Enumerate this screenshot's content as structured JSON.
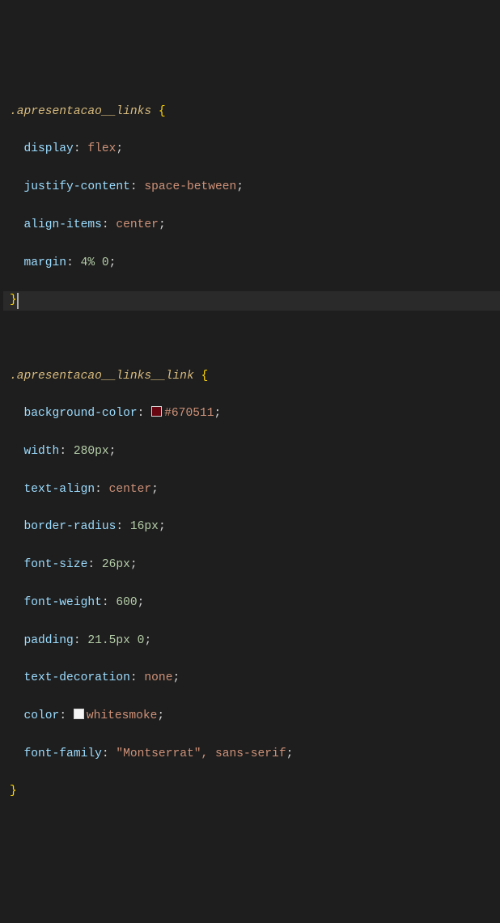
{
  "rule1": {
    "selector": ".apresentacao__links",
    "open": "{",
    "close": "}",
    "decls": [
      {
        "p": "display",
        "v": "flex"
      },
      {
        "p": "justify-content",
        "v": "space-between"
      },
      {
        "p": "align-items",
        "v": "center"
      },
      {
        "p": "margin",
        "n": "4%",
        "n2": "0"
      }
    ]
  },
  "rule2": {
    "selector": ".apresentacao__links__link",
    "open": "{",
    "close": "}",
    "decls": {
      "bg": {
        "p": "background-color",
        "swatch": "#670511",
        "v": "#670511"
      },
      "w": {
        "p": "width",
        "n": "280px"
      },
      "ta": {
        "p": "text-align",
        "v": "center"
      },
      "br": {
        "p": "border-radius",
        "n": "16px"
      },
      "fs": {
        "p": "font-size",
        "n": "26px"
      },
      "fw": {
        "p": "font-weight",
        "n": "600"
      },
      "pad": {
        "p": "padding",
        "n": "21.5px",
        "n2": "0"
      },
      "td": {
        "p": "text-decoration",
        "v": "none"
      },
      "col": {
        "p": "color",
        "swatch": "#f5f5f5",
        "v": "whitesmoke"
      },
      "ff": {
        "p": "font-family",
        "s": "\"Montserrat\"",
        "rest": ", sans-serif"
      }
    }
  }
}
